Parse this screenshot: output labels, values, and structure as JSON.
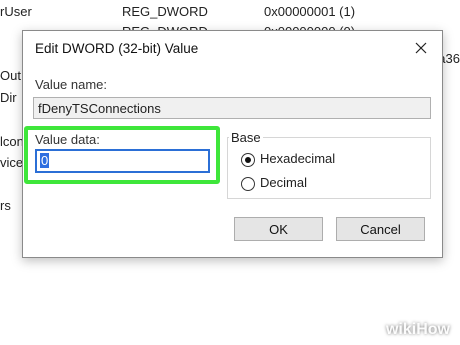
{
  "background": {
    "top_row": {
      "name": "rUser",
      "type": "REG_DWORD",
      "data": "0x00000001 (1)"
    },
    "second_row": {
      "type": "REG_DWORD",
      "data": "0x00000000 (0)"
    },
    "left_fragments": [
      "Out",
      "Dir",
      "lcon",
      "vice",
      "rs"
    ],
    "right_fragment": "a36"
  },
  "dialog": {
    "title": "Edit DWORD (32-bit) Value",
    "value_name_label": "Value name:",
    "value_name": "fDenyTSConnections",
    "value_data_label": "Value data:",
    "value_data": "0",
    "base": {
      "legend": "Base",
      "options": [
        {
          "label": "Hexadecimal",
          "checked": true
        },
        {
          "label": "Decimal",
          "checked": false
        }
      ]
    },
    "ok_label": "OK",
    "cancel_label": "Cancel"
  },
  "watermark": "wikiHow",
  "colors": {
    "highlight": "#3ee63a",
    "focus_border": "#2b6fd6",
    "selection": "#2f6fe0"
  }
}
